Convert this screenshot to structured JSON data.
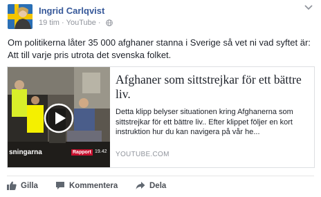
{
  "post": {
    "author": "Ingrid Carlqvist",
    "time": "19 tim",
    "source": "YouTube",
    "text_lines": [
      "Om politikerna låter 35 000 afghaner stanna i Sverige så vet ni vad syftet är:",
      "Att till varje pris utrota det svenska folket."
    ]
  },
  "link": {
    "title": "Afghaner som sittstrejkar för ett bättre liv.",
    "description": "Detta klipp belyser situationen kring Afghanerna som sittstrejkar för ett bättre liv.. Efter klippet följer en kort instruktion hur du kan navigera på vår he...",
    "domain": "YOUTUBE.COM",
    "thumb_caption": "sningarna",
    "thumb_brand": "Rapport",
    "thumb_time": "19.42"
  },
  "actions": {
    "like": "Gilla",
    "comment": "Kommentera",
    "share": "Dela"
  },
  "icons": {
    "avatar": "profile-photo",
    "more": "chevron-down-icon",
    "privacy": "globe-icon",
    "play": "play-icon",
    "like": "thumbs-up-icon",
    "comment": "comment-bubble-icon",
    "share": "share-arrow-icon"
  },
  "colors": {
    "author_link": "#365899",
    "meta_gray": "#90949c",
    "text": "#1d2129",
    "action_gray": "#4b4f56",
    "rapport_red": "#c8102e"
  }
}
